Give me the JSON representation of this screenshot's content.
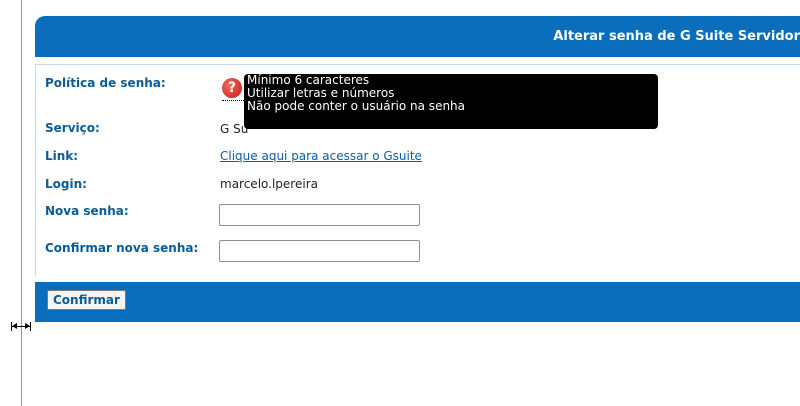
{
  "header": {
    "title": "Alterar senha de G Suite Servidor"
  },
  "form": {
    "policy_label": "Política de senha:",
    "policy_icon": "help-icon",
    "policy_tooltip": [
      "Mínimo 6 caracteres",
      "Utilizar letras e números",
      "Não pode conter o usuário na senha"
    ],
    "service_label": "Serviço:",
    "service_value": "G Su",
    "link_label": "Link:",
    "link_text": "Clique aqui para acessar o Gsuite",
    "login_label": "Login:",
    "login_value": "marcelo.lpereira",
    "new_password_label": "Nova senha:",
    "new_password_value": "",
    "confirm_password_label": "Confirmar nova senha:",
    "confirm_password_value": ""
  },
  "footer": {
    "confirm_button": "Confirmar"
  },
  "colors": {
    "accent": "#0a6ebd",
    "label": "#0a5b97",
    "link": "#0a5ea8",
    "help_icon": "#d9262b"
  }
}
